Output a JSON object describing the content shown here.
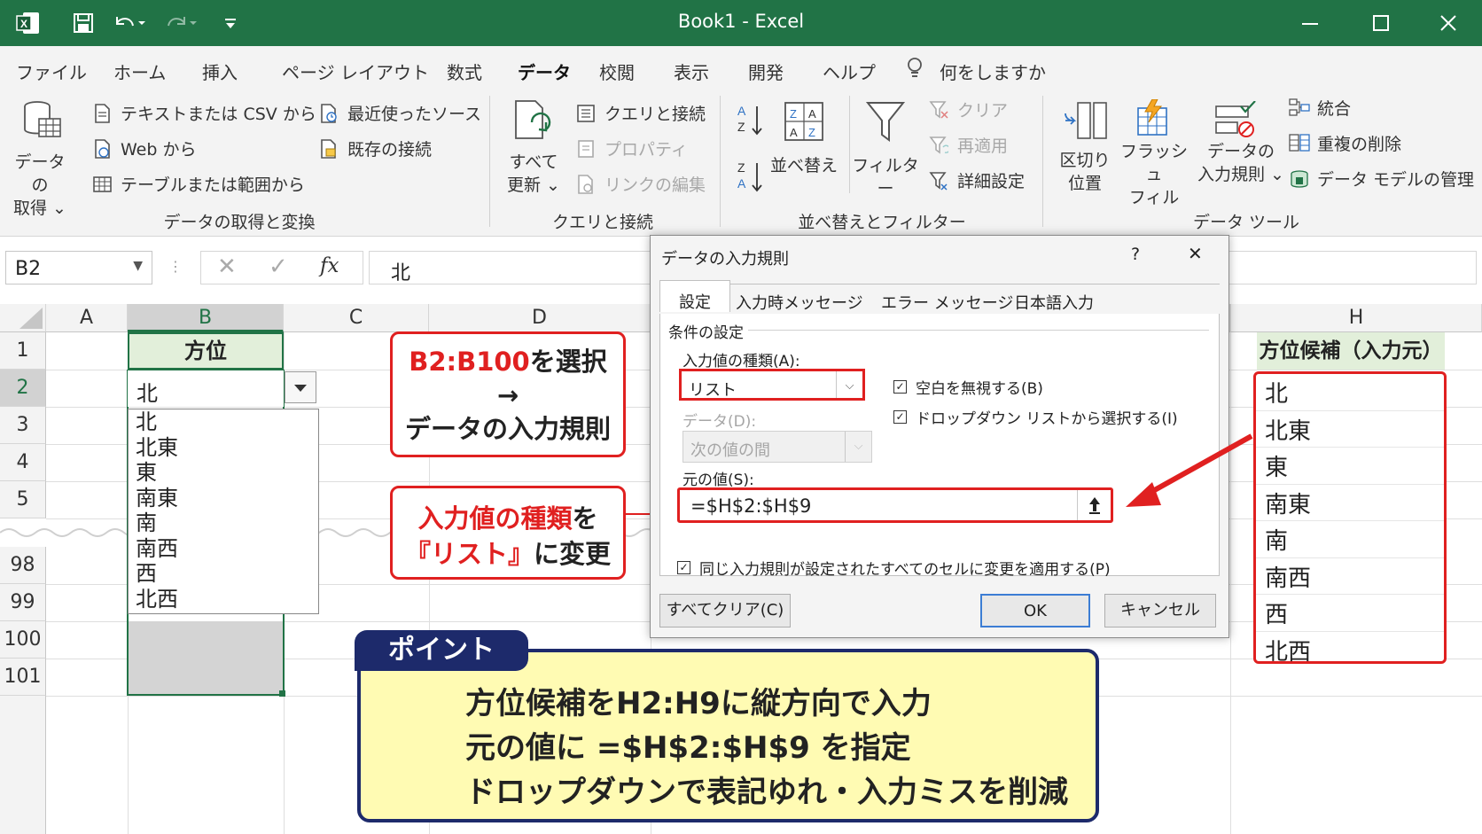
{
  "window": {
    "title": "Book1  -  Excel"
  },
  "menu": [
    "ファイル",
    "ホーム",
    "挿入",
    "ページ レイアウト",
    "数式",
    "データ",
    "校閲",
    "表示",
    "開発",
    "ヘルプ",
    "何をしますか"
  ],
  "ribbon": {
    "get_data": [
      "データの",
      "取得 ⌄"
    ],
    "text_csv": "テキストまたは CSV から",
    "web": "Web から",
    "table_range": "テーブルまたは範囲から",
    "recent_sources": "最近使ったソース",
    "existing_conn": "既存の接続",
    "group1": "データの取得と変換",
    "refresh_all": [
      "すべて",
      "更新 ⌄"
    ],
    "queries_conn": "クエリと接続",
    "properties": "プロパティ",
    "edit_links": "リンクの編集",
    "group2": "クエリと接続",
    "sort": "並べ替え",
    "filter": "フィルター",
    "clear": "クリア",
    "reapply": "再適用",
    "advanced": "詳細設定",
    "group3": "並べ替えとフィルター",
    "text_to_columns": [
      "区切り",
      "位置"
    ],
    "flash_fill": [
      "フラッシュ",
      "フィル"
    ],
    "data_validation": [
      "データの",
      "入力規則 ⌄"
    ],
    "consolidate": "統合",
    "remove_dup": "重複の削除",
    "data_model": "データ モデルの管理",
    "group4": "データ ツール"
  },
  "formula_bar": {
    "name_box": "B2",
    "fx": "fx",
    "content": "北"
  },
  "grid": {
    "columns": [
      "A",
      "B",
      "C",
      "D",
      "H"
    ],
    "rows": [
      "1",
      "2",
      "3",
      "4",
      "5",
      "98",
      "99",
      "100",
      "101"
    ],
    "b1": "方位",
    "b2": "北",
    "h1": "方位候補（入力元）",
    "h_values": [
      "北",
      "北東",
      "東",
      "南東",
      "南",
      "南西",
      "西",
      "北西"
    ],
    "dropdown_items": [
      "北",
      "北東",
      "東",
      "南東",
      "南",
      "南西",
      "西",
      "北西"
    ]
  },
  "callout1": {
    "line1_red": "B2:B100",
    "line1_rest": "を選択",
    "arrow": "→",
    "line2": "データの入力規則"
  },
  "callout2": {
    "line1_red": "入力値の種類",
    "line1_rest": "を",
    "line2_red": "『リスト』",
    "line2_rest": "に変更"
  },
  "dialog": {
    "title": "データの入力規則",
    "help": "?",
    "close": "✕",
    "tabs": [
      "設定",
      "入力時メッセージ",
      "エラー メッセージ",
      "日本語入力"
    ],
    "criteria": "条件の設定",
    "allow_label": "入力値の種類(A):",
    "allow_value": "リスト",
    "data_label": "データ(D):",
    "data_value": "次の値の間",
    "ignore_blank": "空白を無視する(B)",
    "in_cell_dropdown": "ドロップダウン リストから選択する(I)",
    "source_label": "元の値(S):",
    "source_value": "=$H$2:$H$9",
    "apply_all": "同じ入力規則が設定されたすべてのセルに変更を適用する(P)",
    "clear_all": "すべてクリア(C)",
    "ok": "OK",
    "cancel": "キャンセル"
  },
  "point": {
    "tag": "ポイント",
    "lines": [
      "方位候補をH2:H9に縦方向で入力",
      "元の値に =$H$2:$H$9 を指定",
      "ドロップダウンで表記ゆれ・入力ミスを削減"
    ]
  },
  "colors": {
    "excel_green": "#217346",
    "highlight_red": "#e02020",
    "point_navy": "#1d2a6b",
    "point_bg": "#fffbb3",
    "header_green": "#e2efda"
  }
}
